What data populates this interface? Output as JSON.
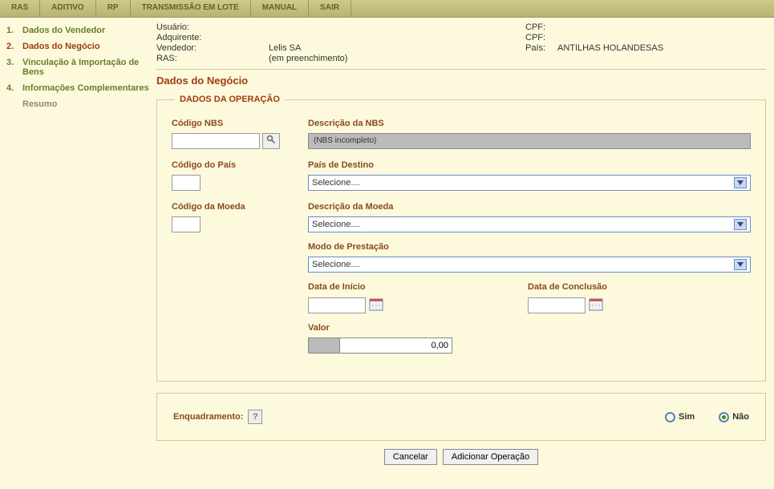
{
  "menu": [
    "RAS",
    "ADITIVO",
    "RP",
    "TRANSMISSÃO EM LOTE",
    "MANUAL",
    "SAIR"
  ],
  "sidebar": {
    "steps": [
      {
        "num": "1.",
        "label": "Dados do Vendedor"
      },
      {
        "num": "2.",
        "label": "Dados do Negócio"
      },
      {
        "num": "3.",
        "label": "Vinculação à Importação de Bens"
      },
      {
        "num": "4.",
        "label": "Informações Complementares"
      }
    ],
    "resumo": "Resumo"
  },
  "info": {
    "usuario_lbl": "Usuário:",
    "usuario_val": "",
    "adquirente_lbl": "Adquirente:",
    "adquirente_val": "",
    "vendedor_lbl": "Vendedor:",
    "vendedor_val": "Lelis SA",
    "ras_lbl": "RAS:",
    "ras_val": "(em preenchimento)",
    "cpf1_lbl": "CPF:",
    "cpf1_val": "",
    "cpf2_lbl": "CPF:",
    "cpf2_val": "",
    "pais_lbl": "País:",
    "pais_val": "ANTILHAS HOLANDESAS"
  },
  "page_title": "Dados do Negócio",
  "fieldset": {
    "legend": "DADOS DA OPERAÇÃO",
    "codigo_nbs": "Código NBS",
    "descricao_nbs": "Descrição da NBS",
    "nbs_text": "(NBS incompleto)",
    "codigo_pais": "Código do País",
    "pais_destino": "País de Destino",
    "codigo_moeda": "Código da Moeda",
    "descricao_moeda": "Descrição da Moeda",
    "modo_prestacao": "Modo de Prestação",
    "selecione": "Selecione....",
    "data_inicio": "Data de Início",
    "data_conclusao": "Data de Conclusão",
    "valor": "Valor",
    "valor_val": "0,00"
  },
  "enq": {
    "label": "Enquadramento:",
    "sim": "Sim",
    "nao": "Não",
    "selected": "nao"
  },
  "buttons": {
    "cancelar": "Cancelar",
    "adicionar": "Adicionar Operação"
  }
}
